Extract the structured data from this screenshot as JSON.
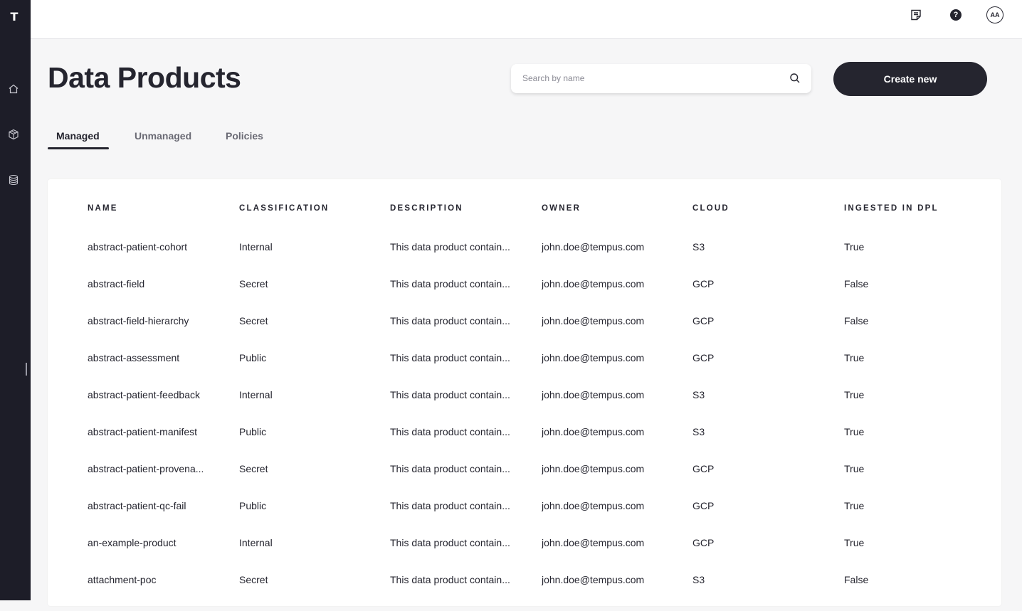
{
  "sidebar": {
    "logo": "T",
    "items": [
      {
        "icon": "home-icon"
      },
      {
        "icon": "cube-icon"
      },
      {
        "icon": "database-icon"
      }
    ]
  },
  "topbar": {
    "icons": [
      "notes-icon",
      "help-icon",
      "avatar"
    ],
    "help_glyph": "?",
    "avatar_initials": "AA"
  },
  "page": {
    "title": "Data Products",
    "search_placeholder": "Search by name",
    "create_label": "Create new"
  },
  "tabs": [
    {
      "label": "Managed",
      "active": true
    },
    {
      "label": "Unmanaged",
      "active": false
    },
    {
      "label": "Policies",
      "active": false
    }
  ],
  "table": {
    "columns": [
      "NAME",
      "CLASSIFICATION",
      "DESCRIPTION",
      "OWNER",
      "CLOUD",
      "INGESTED IN DPL"
    ],
    "rows": [
      [
        "abstract-patient-cohort",
        "Internal",
        "This data product contain...",
        "john.doe@tempus.com",
        "S3",
        "True"
      ],
      [
        "abstract-field",
        "Secret",
        "This data product contain...",
        "john.doe@tempus.com",
        "GCP",
        "False"
      ],
      [
        "abstract-field-hierarchy",
        "Secret",
        "This data product contain...",
        "john.doe@tempus.com",
        "GCP",
        "False"
      ],
      [
        "abstract-assessment",
        "Public",
        "This data product contain...",
        "john.doe@tempus.com",
        "GCP",
        "True"
      ],
      [
        "abstract-patient-feedback",
        "Internal",
        "This data product contain...",
        "john.doe@tempus.com",
        "S3",
        "True"
      ],
      [
        "abstract-patient-manifest",
        "Public",
        "This data product contain...",
        "john.doe@tempus.com",
        "S3",
        "True"
      ],
      [
        "abstract-patient-provena...",
        "Secret",
        "This data product contain...",
        "john.doe@tempus.com",
        "GCP",
        "True"
      ],
      [
        "abstract-patient-qc-fail",
        "Public",
        "This data product contain...",
        "john.doe@tempus.com",
        "GCP",
        "True"
      ],
      [
        "an-example-product",
        "Internal",
        "This data product contain...",
        "john.doe@tempus.com",
        "GCP",
        "True"
      ],
      [
        "attachment-poc",
        "Secret",
        "This data product contain...",
        "john.doe@tempus.com",
        "S3",
        "False"
      ]
    ]
  },
  "colors": {
    "sidebar": "#1d1d28",
    "primary": "#25252f",
    "background": "#f6f6f7"
  }
}
